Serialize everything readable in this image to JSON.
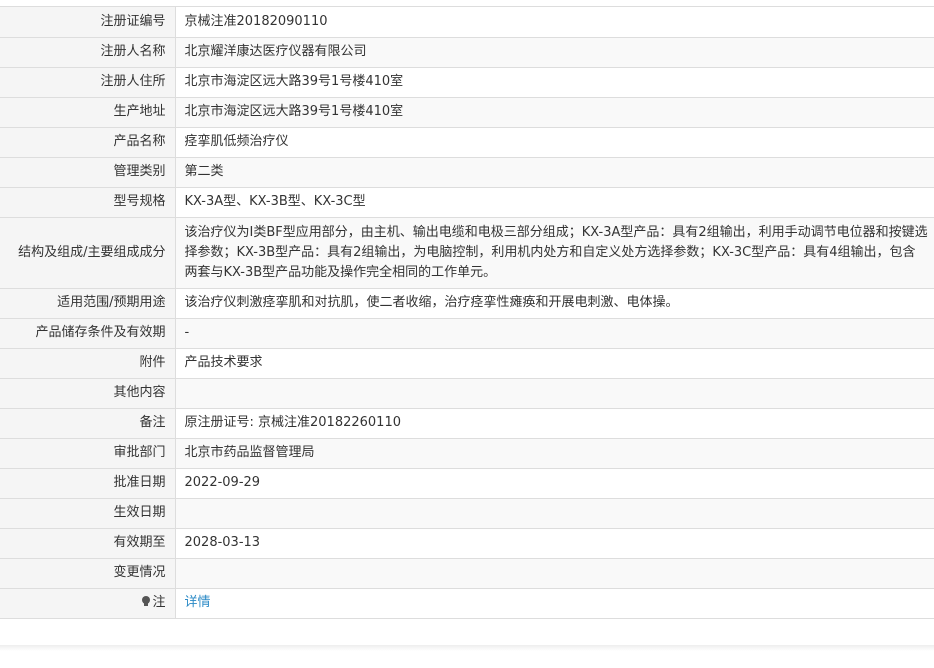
{
  "rows": [
    {
      "label": "注册证编号",
      "value": "京械注准20182090110"
    },
    {
      "label": "注册人名称",
      "value": "北京耀洋康达医疗仪器有限公司"
    },
    {
      "label": "注册人住所",
      "value": "北京市海淀区远大路39号1号楼410室"
    },
    {
      "label": "生产地址",
      "value": "北京市海淀区远大路39号1号楼410室"
    },
    {
      "label": "产品名称",
      "value": "痉挛肌低频治疗仪"
    },
    {
      "label": "管理类别",
      "value": "第二类"
    },
    {
      "label": "型号规格",
      "value": "KX-3A型、KX-3B型、KX-3C型"
    },
    {
      "label": "结构及组成/主要组成成分",
      "value": "该治疗仪为Ⅰ类BF型应用部分，由主机、输出电缆和电极三部分组成；KX-3A型产品：具有2组输出，利用手动调节电位器和按键选择参数；KX-3B型产品：具有2组输出，为电脑控制，利用机内处方和自定义处方选择参数；KX-3C型产品：具有4组输出，包含两套与KX-3B型产品功能及操作完全相同的工作单元。"
    },
    {
      "label": "适用范围/预期用途",
      "value": "该治疗仪刺激痉挛肌和对抗肌，使二者收缩，治疗痉挛性瘫痪和开展电刺激、电体操。"
    },
    {
      "label": "产品储存条件及有效期",
      "value": "-"
    },
    {
      "label": "附件",
      "value": "产品技术要求"
    },
    {
      "label": "其他内容",
      "value": ""
    },
    {
      "label": "备注",
      "value": "原注册证号: 京械注准20182260110"
    },
    {
      "label": "审批部门",
      "value": "北京市药品监督管理局"
    },
    {
      "label": "批准日期",
      "value": "2022-09-29"
    },
    {
      "label": "生效日期",
      "value": ""
    },
    {
      "label": "有效期至",
      "value": "2028-03-13"
    },
    {
      "label": "变更情况",
      "value": ""
    }
  ],
  "note_row": {
    "icon": "lightbulb-icon",
    "label": "注",
    "link_text": "详情"
  },
  "colors": {
    "label_bg": "#f5f5f5",
    "border": "#dddddd",
    "link": "#2b8ac6",
    "text": "#333333"
  }
}
